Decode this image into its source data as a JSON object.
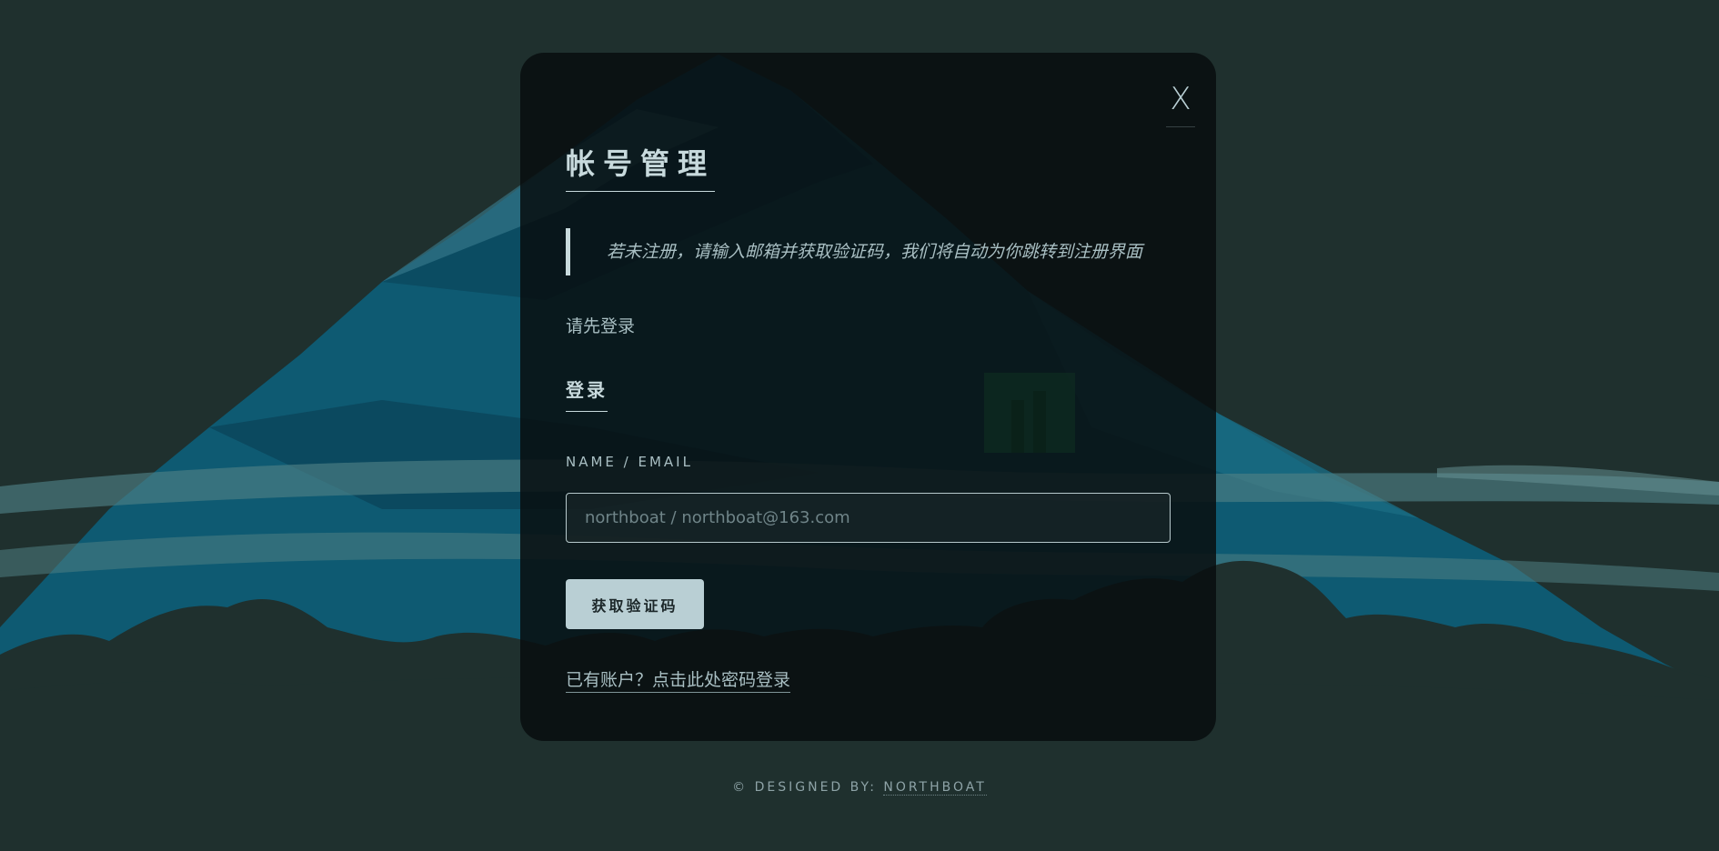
{
  "modal": {
    "close_label": "X",
    "title": "帐号管理",
    "notice": "若未注册，请输入邮箱并获取验证码，我们将自动为你跳转到注册界面",
    "login_prompt": "请先登录",
    "section_title": "登录",
    "field_label": "NAME / EMAIL",
    "input_placeholder": "northboat / northboat@163.com",
    "input_value": "",
    "code_button_label": "获取验证码",
    "password_login_link": "已有账户？点击此处密码登录"
  },
  "footer": {
    "prefix": "© DESIGNED BY: ",
    "author_link": "NORTHBOAT"
  },
  "colors": {
    "background": "#1f302e",
    "mountain": "#0e5a72",
    "modal_bg": "#080e0f",
    "accent": "#b9cfd4",
    "text": "#a9bfc3"
  },
  "icons": {
    "logo": "monitor-logo-icon"
  }
}
